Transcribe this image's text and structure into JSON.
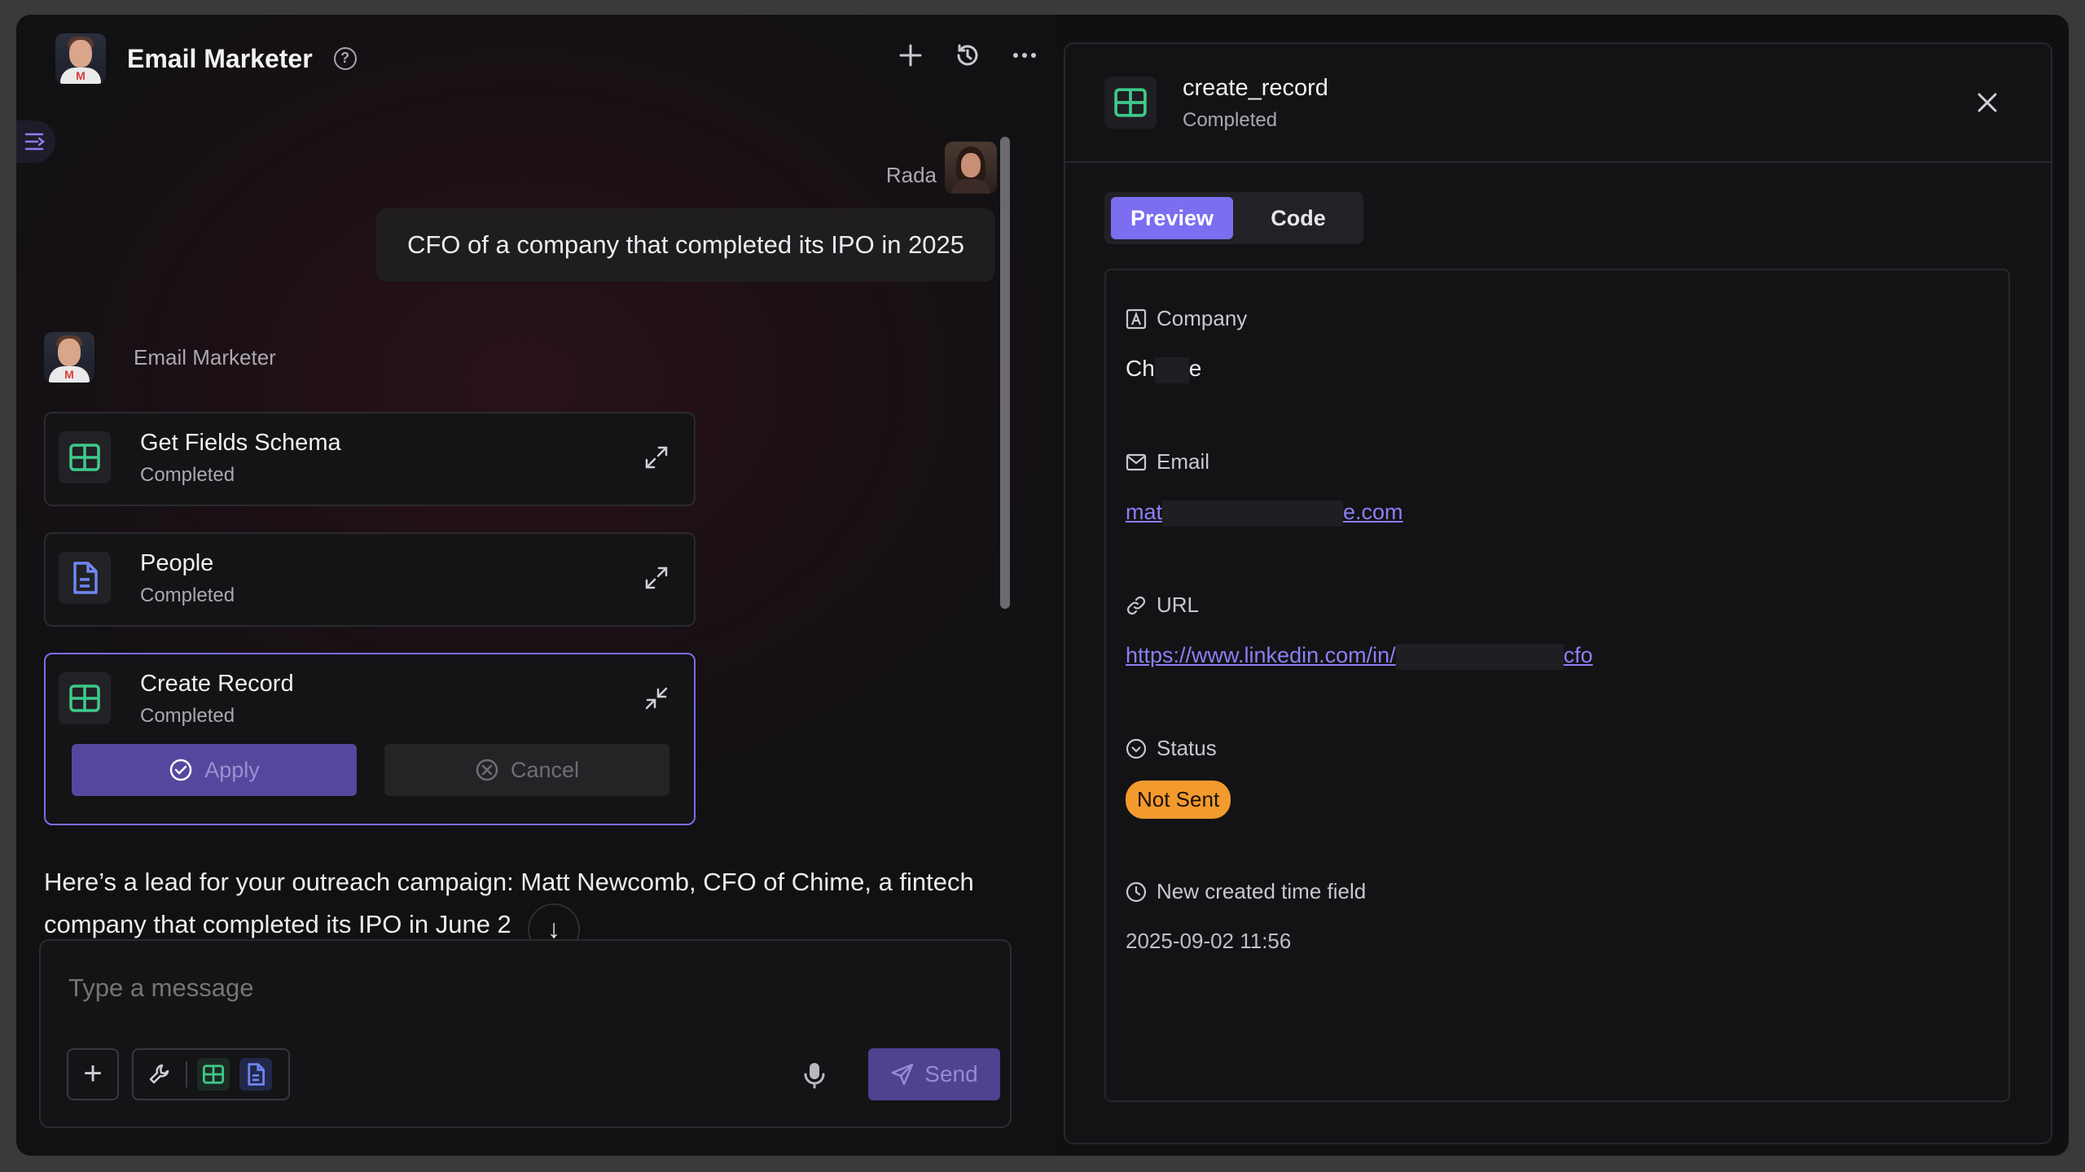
{
  "header": {
    "title": "Email Marketer",
    "help_icon": "help-circle-icon",
    "actions": [
      "plus-icon",
      "history-icon",
      "more-icon"
    ]
  },
  "chat": {
    "user_name": "Rada",
    "user_message": "CFO of a company that completed its IPO in 2025",
    "agent_name": "Email Marketer",
    "tools": [
      {
        "title": "Get Fields Schema",
        "status": "Completed",
        "icon": "table-icon"
      },
      {
        "title": "People",
        "status": "Completed",
        "icon": "document-icon"
      },
      {
        "title": "Create Record",
        "status": "Completed",
        "icon": "table-icon"
      }
    ],
    "apply_label": "Apply",
    "cancel_label": "Cancel",
    "assistant_text": "Here’s a lead for your outreach campaign: Matt Newcomb, CFO of Chime, a fintech company that completed its IPO in June 2"
  },
  "composer": {
    "placeholder": "Type a message",
    "send_label": "Send"
  },
  "panel": {
    "title": "create_record",
    "status": "Completed",
    "tabs": [
      "Preview",
      "Code"
    ],
    "fields": {
      "company": {
        "label": "Company",
        "value_start": "Ch",
        "value_end": "e"
      },
      "email": {
        "label": "Email",
        "value_start": "mat",
        "value_end": "e.com"
      },
      "url": {
        "label": "URL",
        "value_start": "https://www.linkedin.com/in/",
        "value_end": "cfo"
      },
      "status": {
        "label": "Status",
        "value": "Not Sent"
      },
      "created": {
        "label": "New created time field",
        "value": "2025-09-02 11:56"
      }
    }
  },
  "colors": {
    "accent": "#7b6ef0",
    "status_badge": "#f39a2f",
    "table_icon": "#3ec98a",
    "doc_icon": "#6f86f2"
  }
}
